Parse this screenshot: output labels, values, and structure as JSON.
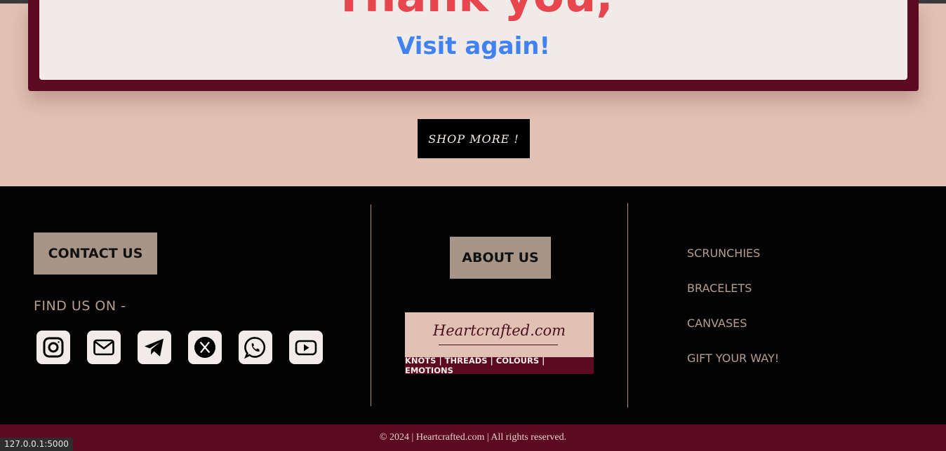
{
  "thank_you": {
    "title": "Thank you,",
    "subtitle": "Visit again!"
  },
  "shop_more_label": "SHOP MORE !",
  "footer": {
    "contact_label": "CONTACT US",
    "find_us_label": "FIND US ON -",
    "socials": [
      {
        "icon": "instagram-icon"
      },
      {
        "icon": "mail-icon"
      },
      {
        "icon": "telegram-icon"
      },
      {
        "icon": "x-icon"
      },
      {
        "icon": "whatsapp-icon"
      },
      {
        "icon": "youtube-icon"
      }
    ],
    "about_label": "ABOUT US",
    "logo": {
      "name": "Heartcrafted.com",
      "tagline": "KNOTS | THREADS | COLOURS | EMOTIONS"
    },
    "links": [
      "SCRUNCHIES",
      "BRACELETS",
      "CANVASES",
      "GIFT YOUR WAY!"
    ],
    "copyright": "© 2024 | Heartcrafted.com | All rights reserved."
  },
  "status_url": "127.0.0.1:5000",
  "colors": {
    "page_bg": "#e2c1b5",
    "maroon": "#5c0a22",
    "title_red": "#e8464e",
    "subtitle_blue": "#3f82f0",
    "button_tan": "#a79687",
    "footer_bg": "#030303"
  }
}
